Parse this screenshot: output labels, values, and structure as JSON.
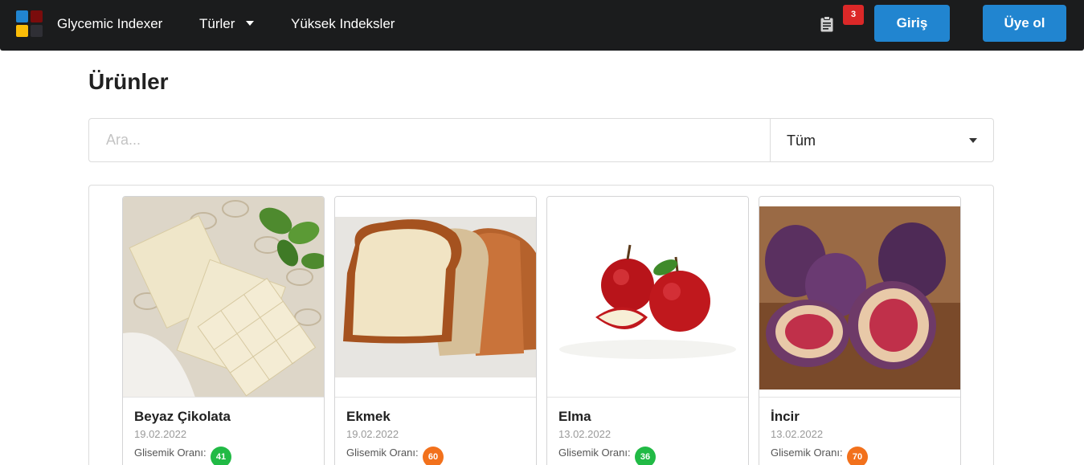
{
  "navbar": {
    "brand": "Glycemic Indexer",
    "types_label": "Türler",
    "high_index_label": "Yüksek Indeksler",
    "cart_count": "3",
    "login_label": "Giriş",
    "signup_label": "Üye ol",
    "icons": [
      "logo-icon",
      "clipboard-icon",
      "caret-down-icon"
    ],
    "logo_colors": [
      "#2185d0",
      "#8b0000",
      "#fbbd08",
      "#333333"
    ]
  },
  "page": {
    "title": "Ürünler"
  },
  "search": {
    "placeholder": "Ara...",
    "type_selected": "Tüm"
  },
  "gi_label": "Glisemik Oranı:",
  "products": [
    {
      "name": "Beyaz Çikolata",
      "date": "19.02.2022",
      "gi": "41",
      "gi_color": "#21ba45"
    },
    {
      "name": "Ekmek",
      "date": "19.02.2022",
      "gi": "60",
      "gi_color": "#f2711c"
    },
    {
      "name": "Elma",
      "date": "13.02.2022",
      "gi": "36",
      "gi_color": "#21ba45"
    },
    {
      "name": "İncir",
      "date": "13.02.2022",
      "gi": "70",
      "gi_color": "#f2711c"
    }
  ]
}
